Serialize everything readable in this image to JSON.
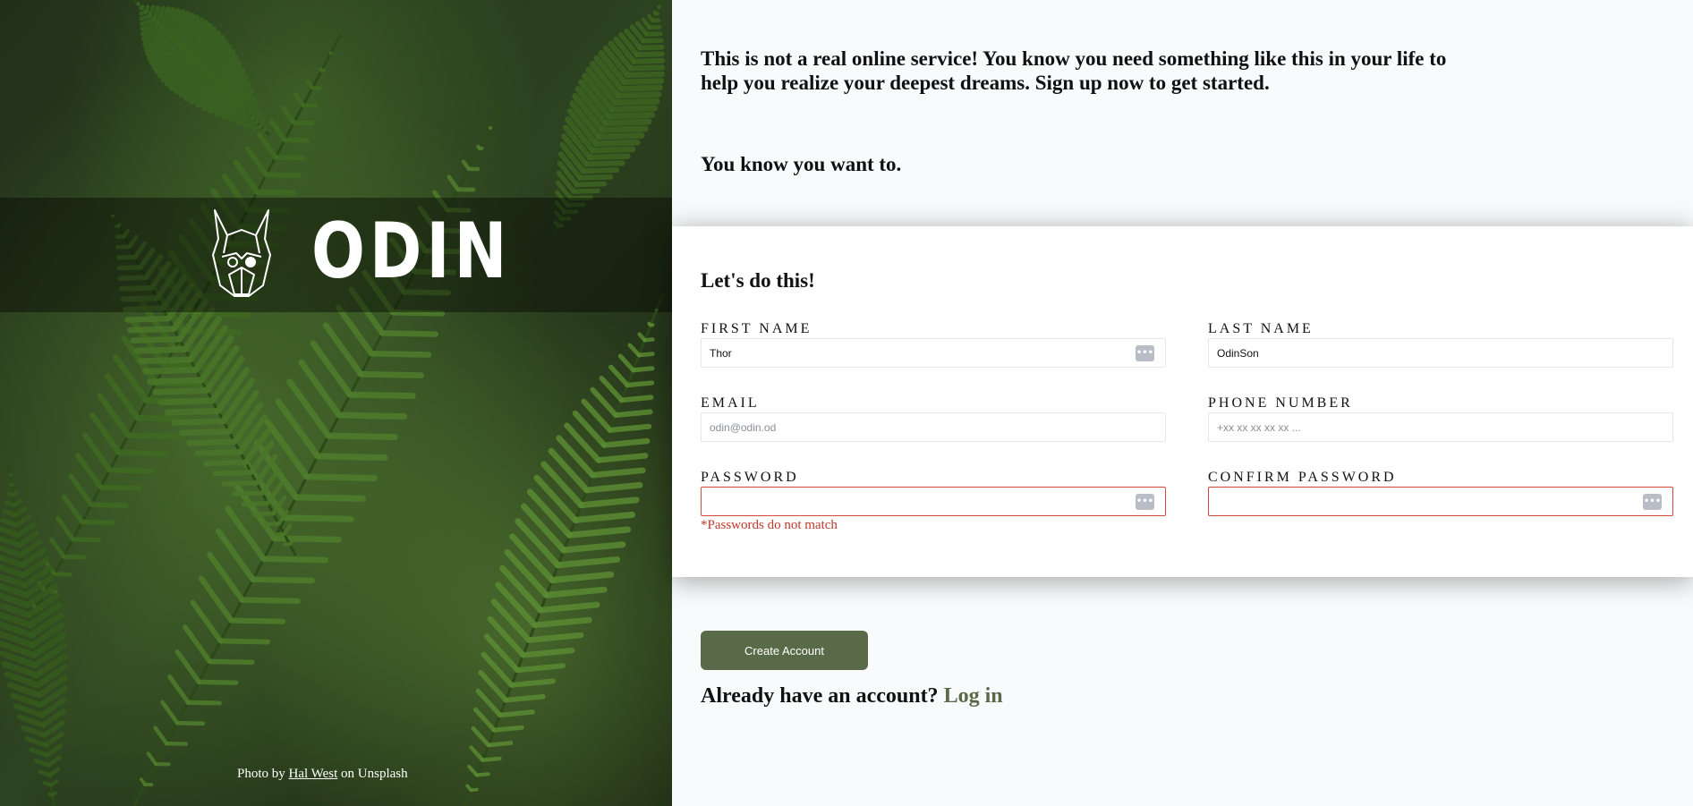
{
  "brand": {
    "name": "ODIN",
    "logo_icon": "odin-viking-icon"
  },
  "photo_credit": {
    "prefix": "Photo by",
    "author": "Hal West",
    "suffix": "on Unsplash"
  },
  "intro": {
    "line1": "This is not a real online service! You know you need something like this in your life to help you realize your deepest dreams. Sign up now to get started.",
    "line2": "You know you want to."
  },
  "form": {
    "title": "Let's do this!",
    "first_name": {
      "label": "FIRST NAME",
      "value": "Thor",
      "placeholder": ""
    },
    "last_name": {
      "label": "LAST NAME",
      "value": "OdinSon",
      "placeholder": ""
    },
    "email": {
      "label": "EMAIL",
      "value": "",
      "placeholder": "odin@odin.od"
    },
    "phone": {
      "label": "PHONE NUMBER",
      "value": "",
      "placeholder": "+xx xx xx xx xx ..."
    },
    "password": {
      "label": "PASSWORD",
      "value": "",
      "placeholder": ""
    },
    "confirm_password": {
      "label": "CONFIRM PASSWORD",
      "value": "",
      "placeholder": ""
    },
    "error": "*Passwords do not match",
    "password_manager_glyph": "•••"
  },
  "actions": {
    "create_label": "Create Account",
    "login_prompt": "Already have an account?",
    "login_link": "Log in"
  },
  "colors": {
    "accent": "#596a48",
    "error": "#d44b3a",
    "page_bg": "#f9fafb"
  }
}
